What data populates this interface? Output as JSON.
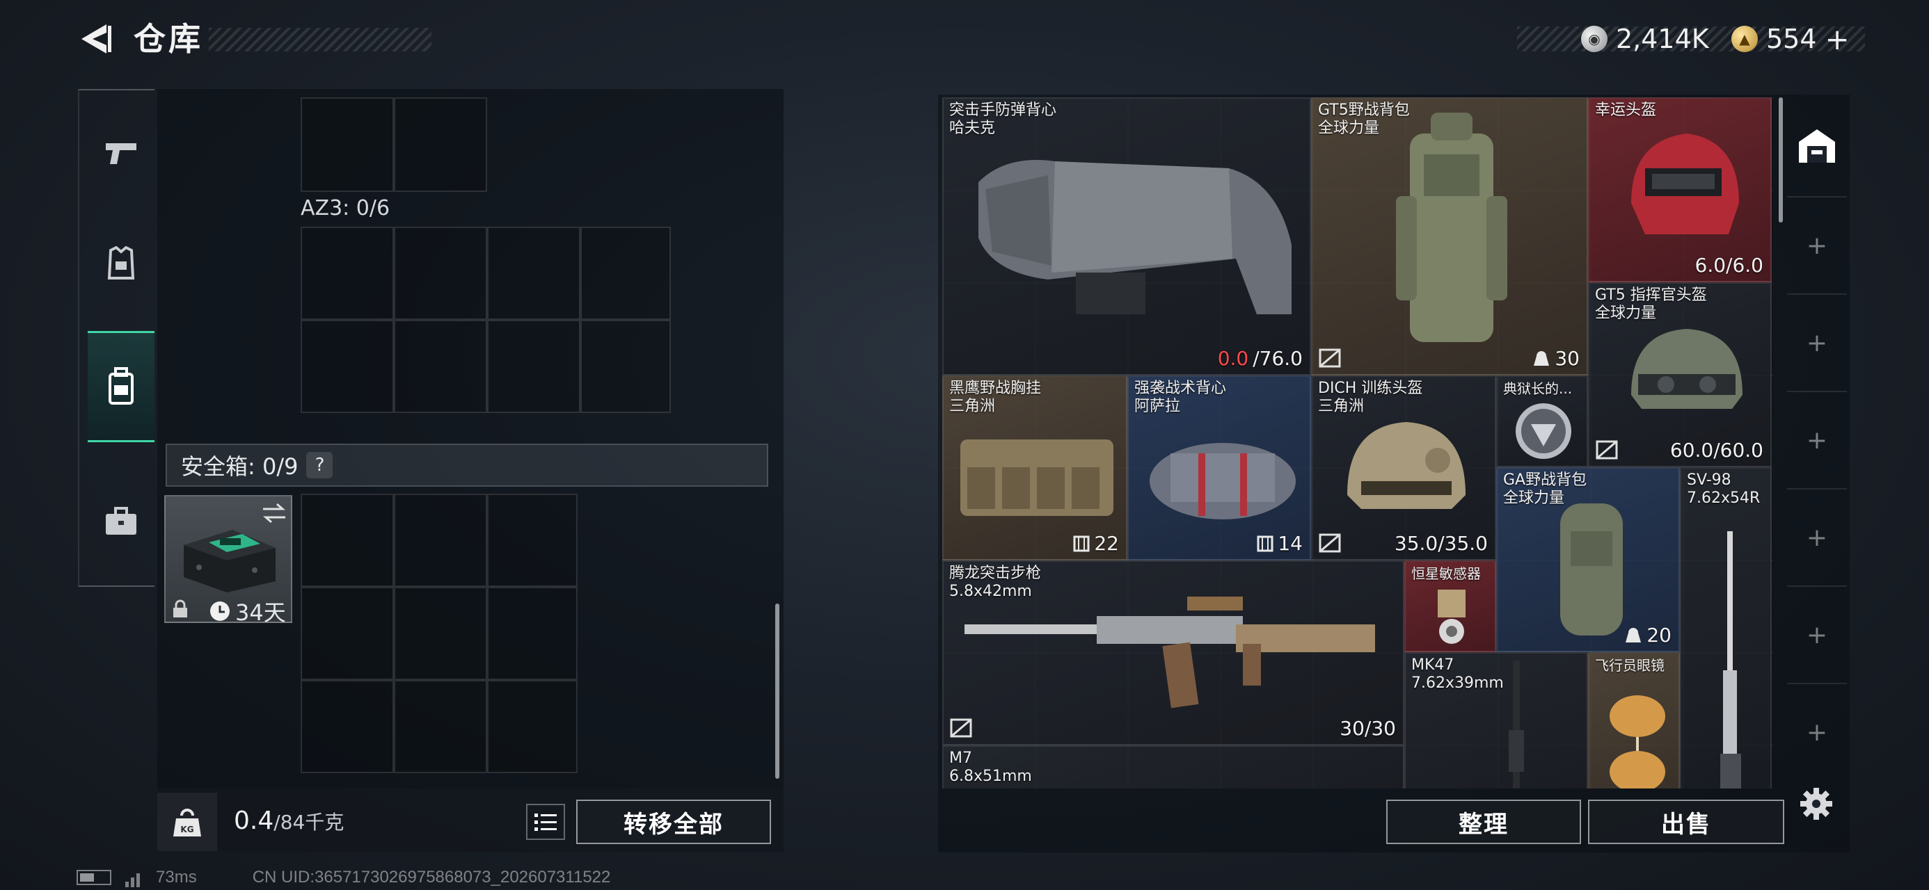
{
  "header": {
    "title": "仓库",
    "currencies": [
      {
        "icon": "silver-coin-icon",
        "value": "2,414K"
      },
      {
        "icon": "gold-coin-icon",
        "value": "554",
        "add": "+"
      }
    ]
  },
  "side_tabs": [
    {
      "name": "pistol-icon",
      "active": false
    },
    {
      "name": "armor-vest-icon",
      "active": false
    },
    {
      "name": "backpack-icon",
      "active": true
    },
    {
      "name": "briefcase-icon",
      "active": false
    }
  ],
  "left": {
    "az3_label": "AZ3: 0/6",
    "safe_box": {
      "label": "安全箱: 0/9",
      "help": "?",
      "days": "34天"
    },
    "weight": {
      "current": "0.4",
      "max": "/84千克"
    },
    "transfer_all": "转移全部"
  },
  "items": [
    {
      "name": "突击手防弹背心",
      "sub": "哈夫克",
      "durability_current": "0.0",
      "durability_max": "/76.0"
    },
    {
      "name": "GT5野战背包",
      "sub": "全球力量",
      "capacity": "30"
    },
    {
      "name": "幸运头盔",
      "sub": "",
      "stat": "6.0/6.0"
    },
    {
      "name": "GT5 指挥官头盔",
      "sub": "全球力量",
      "stat": "60.0/60.0"
    },
    {
      "name": "黑鹰野战胸挂",
      "sub": "三角洲",
      "capacity": "22"
    },
    {
      "name": "强袭战术背心",
      "sub": "阿萨拉",
      "capacity": "14"
    },
    {
      "name": "DICH 训练头盔",
      "sub": "三角洲",
      "stat": "35.0/35.0"
    },
    {
      "name": "典狱长的...",
      "sub": ""
    },
    {
      "name": "GA野战背包",
      "sub": "全球力量",
      "capacity": "20"
    },
    {
      "name": "SV-98",
      "sub": "7.62x54R"
    },
    {
      "name": "腾龙突击步枪",
      "sub": "5.8x42mm",
      "stat": "30/30"
    },
    {
      "name": "恒星敏感器",
      "sub": ""
    },
    {
      "name": "MK47",
      "sub": "7.62x39mm"
    },
    {
      "name": "飞行员眼镜",
      "sub": ""
    },
    {
      "name": "M7",
      "sub": "6.8x51mm"
    }
  ],
  "actions": {
    "sort": "整理",
    "sell": "出售"
  },
  "footer": {
    "ping": "73ms",
    "uid": "CN UID:3657173026975868073_202607311522"
  }
}
